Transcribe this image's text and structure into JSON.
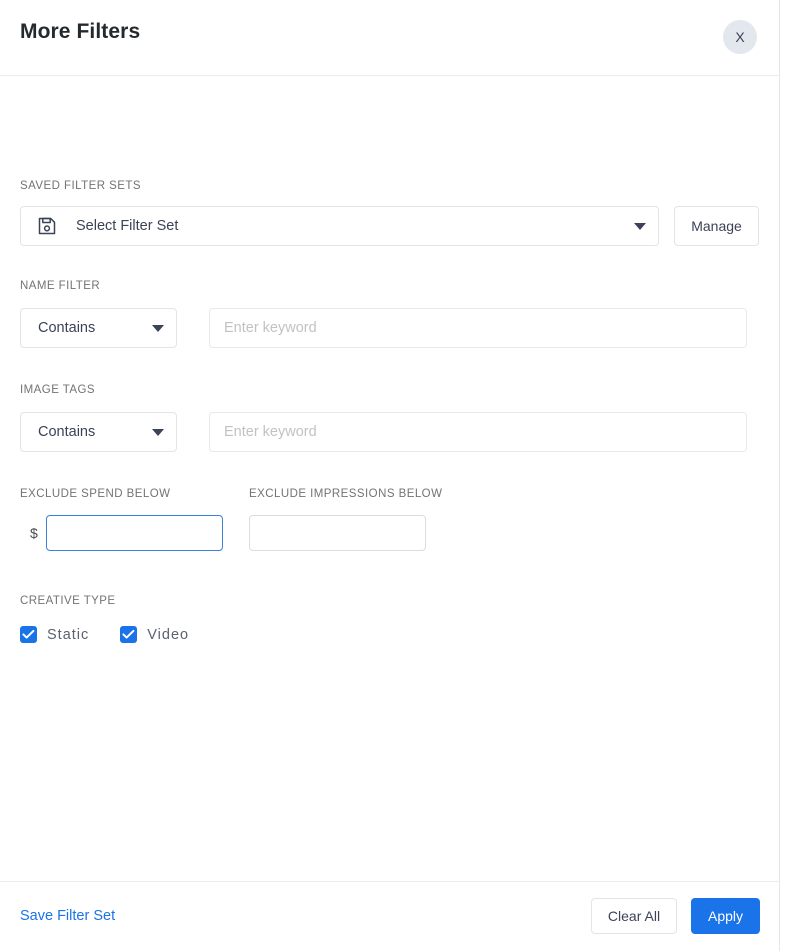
{
  "header": {
    "title": "More Filters",
    "close_label": "X",
    "close_icon": "close-icon"
  },
  "saved_filter_sets": {
    "label": "SAVED FILTER SETS",
    "icon": "save-floppy-icon",
    "select_value": "Select Filter Set",
    "caret_icon": "chevron-down-icon",
    "manage_label": "Manage"
  },
  "name_filter": {
    "label": "NAME FILTER",
    "operator": "Contains",
    "caret_icon": "chevron-down-icon",
    "keyword_value": "",
    "keyword_placeholder": "Enter keyword"
  },
  "image_tags": {
    "label": "IMAGE TAGS",
    "operator": "Contains",
    "caret_icon": "chevron-down-icon",
    "keyword_value": "",
    "keyword_placeholder": "Enter keyword"
  },
  "exclude_spend": {
    "label": "EXCLUDE SPEND BELOW",
    "currency_symbol": "$",
    "value": "",
    "placeholder": ""
  },
  "exclude_impressions": {
    "label": "EXCLUDE IMPRESSIONS BELOW",
    "value": "",
    "placeholder": ""
  },
  "creative_type": {
    "label": "CREATIVE TYPE",
    "options": [
      {
        "label": "Static",
        "checked": true
      },
      {
        "label": "Video",
        "checked": true
      }
    ]
  },
  "footer": {
    "save_filter_set_label": "Save Filter Set",
    "clear_all_label": "Clear All",
    "apply_label": "Apply"
  },
  "colors": {
    "accent_blue": "#1a73e8",
    "focus_blue": "#3b82d6",
    "close_bg": "#e3e7ee",
    "text_dark": "#3c4257",
    "label_gray": "#737373",
    "border_gray": "#e4e4e4"
  }
}
